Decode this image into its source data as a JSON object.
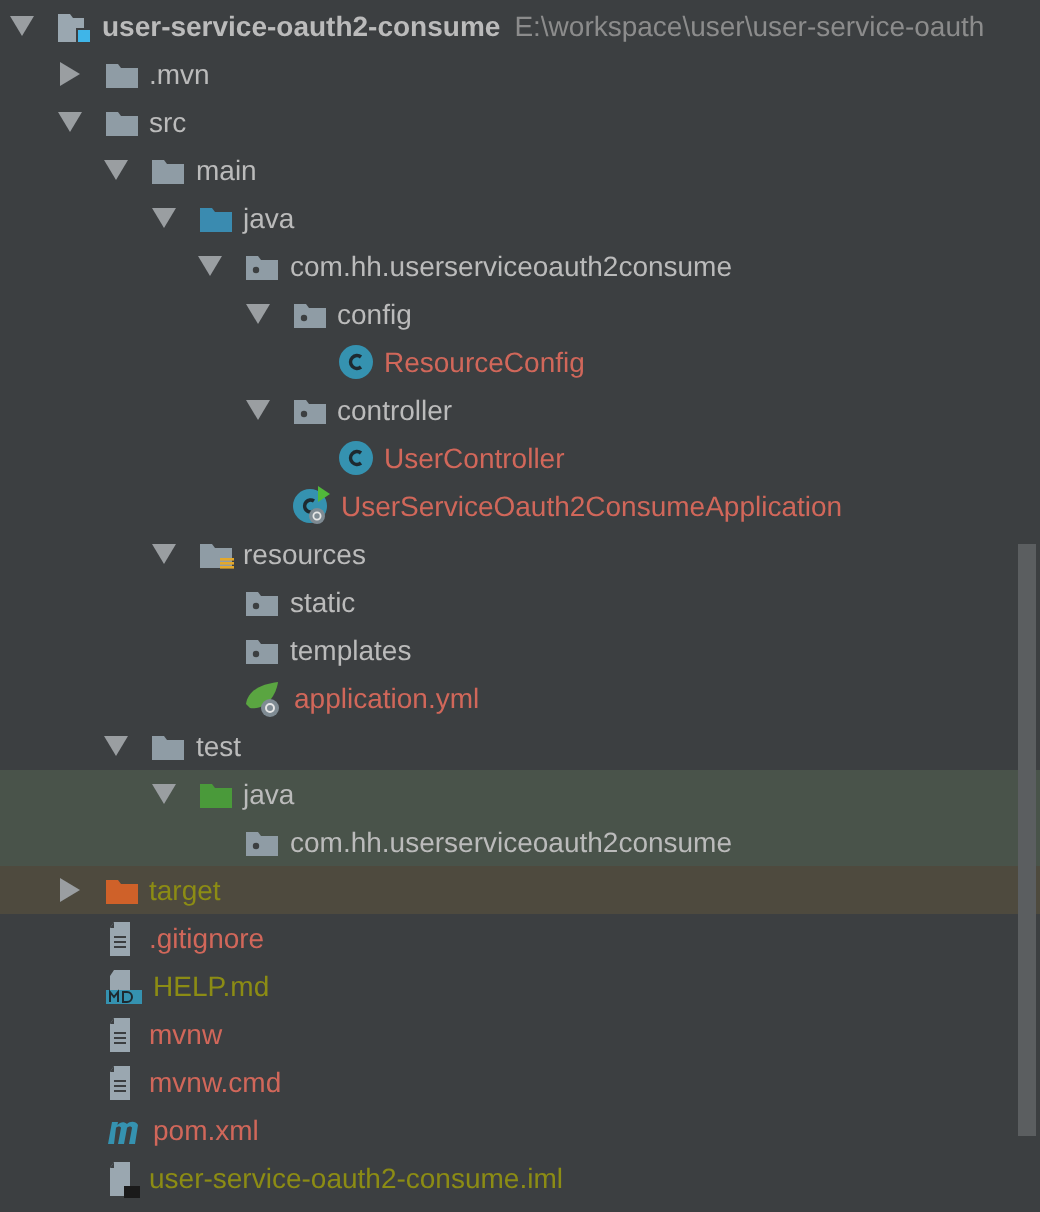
{
  "project_tree": {
    "name": "user-service-oauth2-consume",
    "kind": "module",
    "path": "E:\\workspace\\user\\user-service-oauth",
    "expanded": true,
    "children": [
      {
        "name": ".mvn",
        "kind": "folder",
        "color": "#bbbbbb",
        "expanded": false
      },
      {
        "name": "src",
        "kind": "folder",
        "color": "#bbbbbb",
        "expanded": true,
        "children": [
          {
            "name": "main",
            "kind": "folder",
            "color": "#bbbbbb",
            "expanded": true,
            "children": [
              {
                "name": "java",
                "kind": "source-folder",
                "color": "#bbbbbb",
                "expanded": true,
                "children": [
                  {
                    "name": "com.hh.userserviceoauth2consume",
                    "kind": "package",
                    "color": "#bbbbbb",
                    "expanded": true,
                    "children": [
                      {
                        "name": "config",
                        "kind": "package",
                        "color": "#bbbbbb",
                        "expanded": true,
                        "children": [
                          {
                            "name": "ResourceConfig",
                            "kind": "class",
                            "color": "#d1675a"
                          }
                        ]
                      },
                      {
                        "name": "controller",
                        "kind": "package",
                        "color": "#bbbbbb",
                        "expanded": true,
                        "children": [
                          {
                            "name": "UserController",
                            "kind": "class",
                            "color": "#d1675a"
                          }
                        ]
                      },
                      {
                        "name": "UserServiceOauth2ConsumeApplication",
                        "kind": "spring-class",
                        "color": "#d1675a"
                      }
                    ]
                  }
                ]
              },
              {
                "name": "resources",
                "kind": "resources-folder",
                "color": "#bbbbbb",
                "expanded": true,
                "children": [
                  {
                    "name": "static",
                    "kind": "package",
                    "color": "#bbbbbb"
                  },
                  {
                    "name": "templates",
                    "kind": "package",
                    "color": "#bbbbbb"
                  },
                  {
                    "name": "application.yml",
                    "kind": "spring-config",
                    "color": "#d1675a"
                  }
                ]
              }
            ]
          },
          {
            "name": "test",
            "kind": "folder",
            "color": "#bbbbbb",
            "expanded": true,
            "children": [
              {
                "name": "java",
                "kind": "test-folder",
                "color": "#bbbbbb",
                "test_source": true,
                "expanded": true,
                "children": [
                  {
                    "name": "com.hh.userserviceoauth2consume",
                    "kind": "package",
                    "color": "#bbbbbb",
                    "test_source": true
                  }
                ]
              }
            ]
          }
        ]
      },
      {
        "name": "target",
        "kind": "excluded-folder",
        "color": "#8c8c14",
        "excluded": true,
        "expanded": false
      },
      {
        "name": ".gitignore",
        "kind": "text-file",
        "color": "#d1675a"
      },
      {
        "name": "HELP.md",
        "kind": "markdown-file",
        "color": "#8c8c14"
      },
      {
        "name": "mvnw",
        "kind": "text-file",
        "color": "#d1675a"
      },
      {
        "name": "mvnw.cmd",
        "kind": "text-file",
        "color": "#d1675a"
      },
      {
        "name": "pom.xml",
        "kind": "maven-file",
        "color": "#d1675a"
      },
      {
        "name": "user-service-oauth2-consume.iml",
        "kind": "module-file",
        "color": "#8c8c14"
      }
    ]
  }
}
